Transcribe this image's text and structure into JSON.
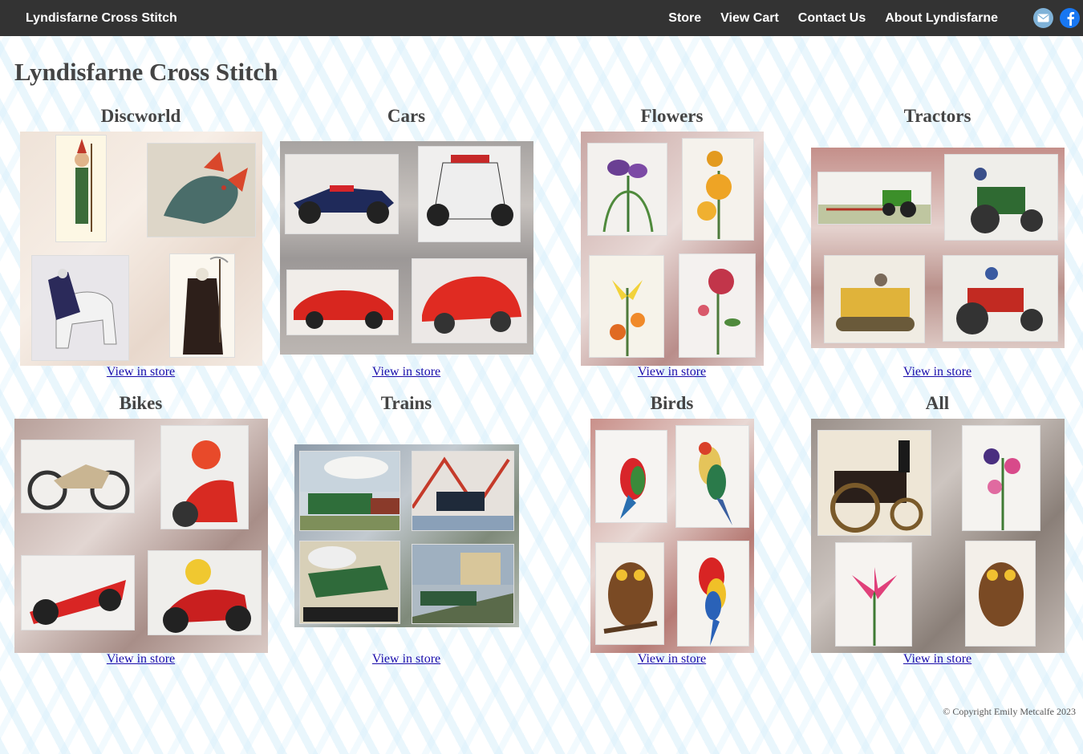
{
  "nav": {
    "brand": "Lyndisfarne Cross Stitch",
    "links": [
      "Store",
      "View Cart",
      "Contact Us",
      "About Lyndisfarne"
    ],
    "icons": [
      "mail-icon",
      "facebook-icon"
    ]
  },
  "page": {
    "title": "Lyndisfarne Cross Stitch"
  },
  "categories": [
    {
      "title": "Discworld",
      "link": "View in store"
    },
    {
      "title": "Cars",
      "link": "View in store"
    },
    {
      "title": "Flowers",
      "link": "View in store"
    },
    {
      "title": "Tractors",
      "link": "View in store"
    },
    {
      "title": "Bikes",
      "link": "View in store"
    },
    {
      "title": "Trains",
      "link": "View in store"
    },
    {
      "title": "Birds",
      "link": "View in store"
    },
    {
      "title": "All",
      "link": "View in store"
    }
  ],
  "footer": {
    "copyright": "© Copyright Emily Metcalfe 2023"
  },
  "colors": {
    "navbar": "#333333",
    "link": "#1a0dab",
    "heading": "#444444"
  }
}
